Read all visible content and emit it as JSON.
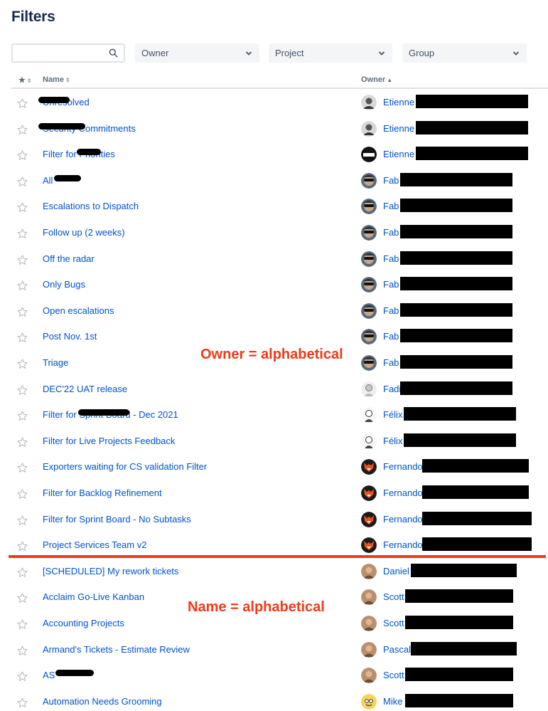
{
  "page": {
    "title": "Filters"
  },
  "search": {
    "placeholder": "",
    "icon": "search-icon"
  },
  "filters": [
    {
      "label": "Owner",
      "icon": "chevron-down-icon"
    },
    {
      "label": "Project",
      "icon": "chevron-down-icon"
    },
    {
      "label": "Group",
      "icon": "chevron-down-icon"
    }
  ],
  "table": {
    "headers": {
      "starred": "★",
      "name": "Name",
      "owner": "Owner"
    },
    "sort": {
      "column": "Owner",
      "direction": "ascending"
    },
    "rows": [
      {
        "name": "Unresolved",
        "owner": "Etienne",
        "avatar": "mono-avatar-icon"
      },
      {
        "name": "Security Commitments",
        "owner": "Etienne",
        "avatar": "mono-avatar-icon"
      },
      {
        "name": "Filter for Priorities",
        "owner": "Etienne",
        "avatar": "helmet-avatar-icon"
      },
      {
        "name": "All",
        "owner": "Fab",
        "avatar": "sunglasses-avatar-icon"
      },
      {
        "name": "Escalations to Dispatch",
        "owner": "Fab",
        "avatar": "sunglasses-avatar-icon"
      },
      {
        "name": "Follow up (2 weeks)",
        "owner": "Fab",
        "avatar": "sunglasses-avatar-icon"
      },
      {
        "name": "Off the radar",
        "owner": "Fab",
        "avatar": "sunglasses-avatar-icon"
      },
      {
        "name": "Only Bugs",
        "owner": "Fab",
        "avatar": "sunglasses-avatar-icon"
      },
      {
        "name": "Open escalations",
        "owner": "Fab",
        "avatar": "sunglasses-avatar-icon"
      },
      {
        "name": "Post Nov. 1st",
        "owner": "Fab",
        "avatar": "sunglasses-avatar-icon"
      },
      {
        "name": "Triage",
        "owner": "Fab",
        "avatar": "sunglasses-avatar-icon"
      },
      {
        "name": "DEC'22 UAT release",
        "owner": "Fadi",
        "avatar": "person-avatar-icon"
      },
      {
        "name": "Filter for Sprint Board - Dec 2021",
        "owner": "Félix",
        "avatar": "sketch-avatar-icon"
      },
      {
        "name": "Filter for Live Projects Feedback",
        "owner": "Félix",
        "avatar": "sketch-avatar-icon"
      },
      {
        "name": "Exporters waiting for CS validation Filter",
        "owner": "Fernando",
        "avatar": "fox-avatar-icon"
      },
      {
        "name": "Filter for Backlog Refinement",
        "owner": "Fernando",
        "avatar": "fox-avatar-icon"
      },
      {
        "name": "Filter for Sprint Board - No Subtasks",
        "owner": "Fernando",
        "avatar": "fox-avatar-icon"
      },
      {
        "name": "Project Services Team v2",
        "owner": "Fernando",
        "avatar": "fox-avatar-icon"
      },
      {
        "name": "[SCHEDULED] My rework tickets",
        "owner": "Daniel",
        "avatar": "photo-avatar-icon"
      },
      {
        "name": "Acclaim Go-Live Kanban",
        "owner": "Scott",
        "avatar": "photo-avatar-icon"
      },
      {
        "name": "Accounting Projects",
        "owner": "Scott",
        "avatar": "photo-avatar-icon"
      },
      {
        "name": "Armand's Tickets - Estimate Review",
        "owner": "Pascal",
        "avatar": "photo-avatar-icon"
      },
      {
        "name": "AS",
        "owner": "Scott",
        "avatar": "photo-avatar-icon"
      },
      {
        "name": "Automation Needs Grooming",
        "owner": "Mike",
        "avatar": "cartoon-avatar-icon"
      }
    ]
  },
  "annotations": {
    "owner_note": "Owner = alphabetical",
    "name_note": "Name = alphabetical",
    "color": "#f03a17"
  },
  "colors": {
    "link": "#0052cc",
    "heading": "#172b4d",
    "header_text": "#5e6c84"
  }
}
